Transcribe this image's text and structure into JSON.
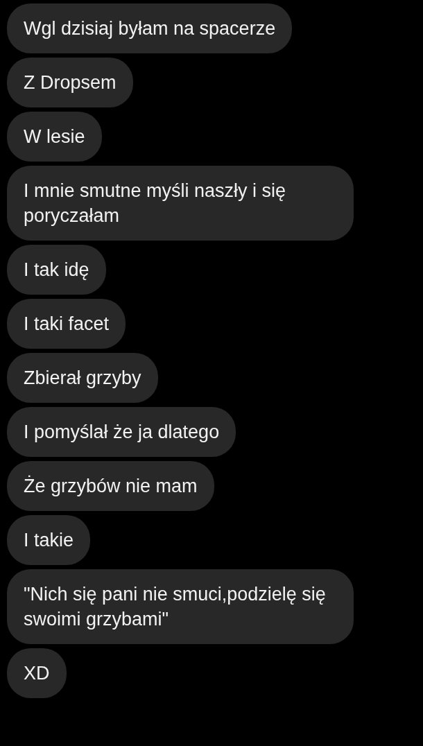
{
  "messages": [
    {
      "text": "Wgl dzisiaj byłam na spacerze"
    },
    {
      "text": "Z Dropsem"
    },
    {
      "text": "W lesie"
    },
    {
      "text": "I mnie smutne myśli naszły i się poryczałam"
    },
    {
      "text": "I tak idę"
    },
    {
      "text": "I taki facet"
    },
    {
      "text": "Zbierał grzyby"
    },
    {
      "text": "I pomyślał że ja dlatego"
    },
    {
      "text": "Że grzybów nie mam"
    },
    {
      "text": "I takie"
    },
    {
      "text": "\"Nich się pani nie smuci,podzielę się swoimi grzybami\""
    },
    {
      "text": "XD"
    }
  ]
}
